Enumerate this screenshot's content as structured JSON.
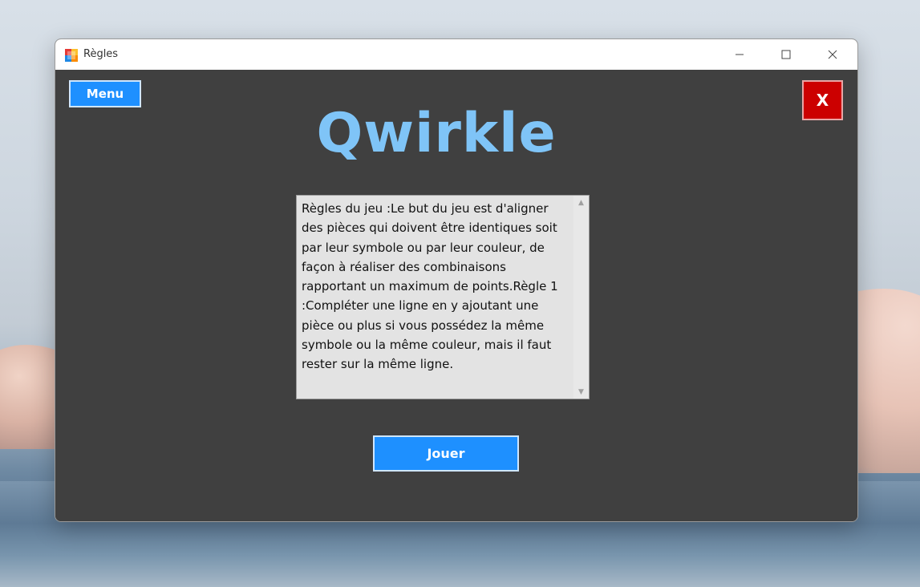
{
  "window": {
    "title": "Règles"
  },
  "titlebar": {
    "minimize_icon": "minimize-icon",
    "maximize_icon": "maximize-icon",
    "close_icon": "close-icon"
  },
  "content": {
    "menu_label": "Menu",
    "close_label": "X",
    "logo_text": "Qwirkle",
    "rules_text": "Règles du jeu :Le but du jeu est d'aligner des pièces qui doivent être identiques soit par leur symbole ou par leur couleur, de façon à réaliser des combinaisons rapportant un maximum de points.Règle 1 :Compléter une ligne en y ajoutant une pièce ou plus si vous possédez la même symbole ou la même couleur, mais il faut rester sur la même ligne.",
    "play_label": "Jouer"
  },
  "colors": {
    "background": "#404040",
    "accent_blue": "#1e90ff",
    "logo_blue": "#7fc4f7",
    "close_red": "#cc0000"
  }
}
